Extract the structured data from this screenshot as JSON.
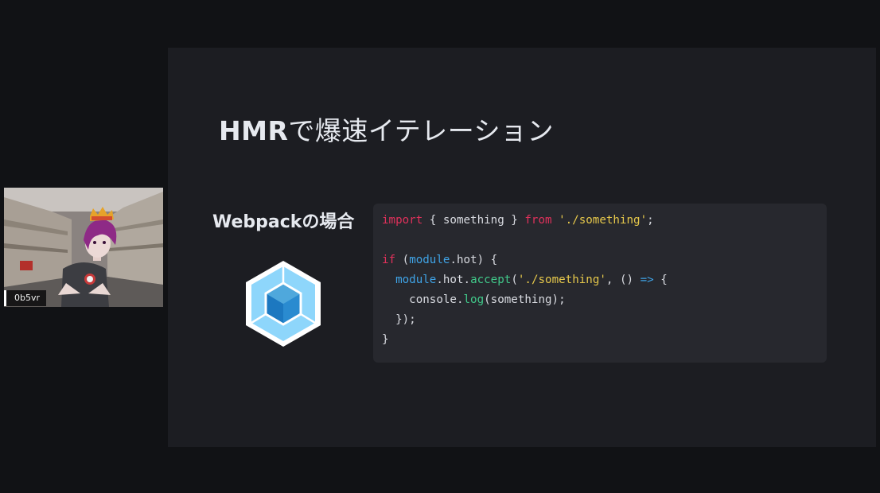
{
  "slide": {
    "title_latin": "HMR",
    "title_jp": "で爆速イテレーション",
    "subheading": "Webpackの場合",
    "code": {
      "line1": {
        "kw_import": "import",
        "text1": " { something } ",
        "kw_from": "from",
        "sp": " ",
        "str": "'./something'",
        "end": ";"
      },
      "line3": {
        "kw_if": "if",
        "open": " (",
        "id_module": "module",
        "rest": ".hot) {"
      },
      "line4": {
        "indent": "  ",
        "id_module": "module",
        "hot": ".hot.",
        "fn_accept": "accept",
        "open": "(",
        "str": "'./something'",
        "mid": ", () ",
        "arrow": "=>",
        "end": " {"
      },
      "line5": {
        "indent": "    console.",
        "fn_log": "log",
        "rest": "(something);"
      },
      "line6": "  });",
      "line7": "}"
    }
  },
  "presenter": {
    "name": "0b5vr"
  },
  "logo": {
    "name": "webpack-logo-icon"
  },
  "colors": {
    "slide_bg": "#1c1d22",
    "code_bg": "#27282e",
    "keyword": "#e0315b",
    "string": "#e6c84b",
    "identifier": "#3fa3e6",
    "function": "#41c98a"
  }
}
